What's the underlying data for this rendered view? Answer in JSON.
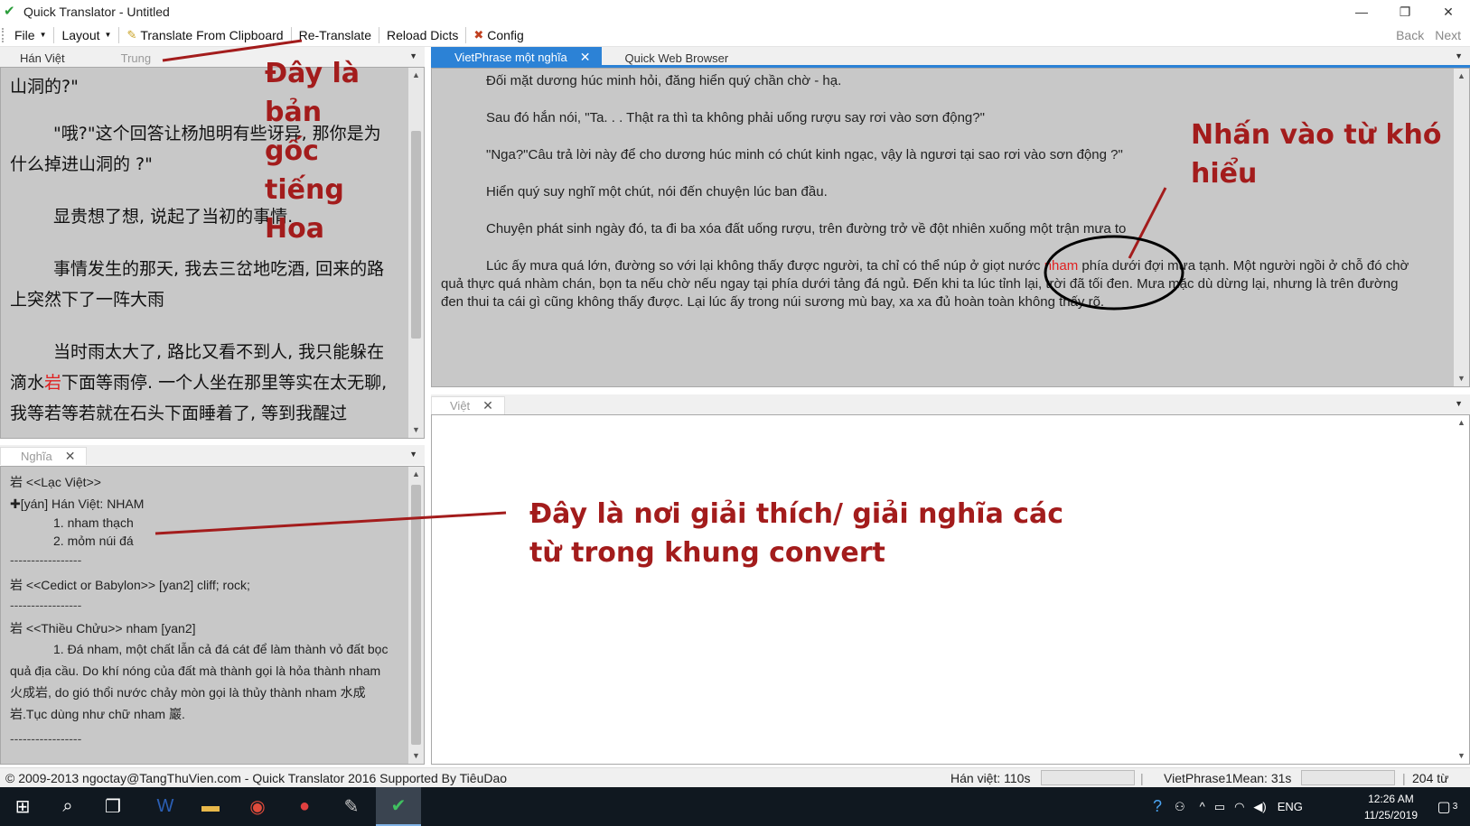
{
  "window": {
    "title": "Quick Translator - Untitled",
    "min": "—",
    "restore": "❐",
    "close": "✕"
  },
  "menu": {
    "file": "File",
    "layout": "Layout",
    "clipboard": "Translate From Clipboard",
    "retranslate": "Re-Translate",
    "reload": "Reload Dicts",
    "config": "Config",
    "back": "Back",
    "next": "Next"
  },
  "tabs_left": {
    "han_viet": "Hán Việt",
    "trung": "Trung"
  },
  "tabs_right": {
    "vietphrase": "VietPhrase một nghĩa",
    "browser": "Quick Web Browser"
  },
  "tab_viet": "Việt",
  "tab_nghia": "Nghĩa",
  "chinese": {
    "l1": "山洞的?\"",
    "p2": "\"哦?\"这个回答让杨旭明有些讶异, 那你是为什么掉进山洞的 ?\"",
    "p3": "显贵想了想, 说起了当初的事情.",
    "p4": "事情发生的那天, 我去三岔地吃酒, 回来的路上突然下了一阵大雨",
    "p5a": "当时雨太大了, 路比又看不到人, 我只能躲在滴水",
    "p5b": "岩",
    "p5c": "下面等雨停. 一个人坐在那里等实在太无聊, 我等若等若就在石头下面睡着了, 等到我醒过"
  },
  "vietphrase": {
    "p1": "Đối mặt dương húc minh hỏi, đăng hiển quý chần chờ - hạ.",
    "p2": "Sau đó hắn nói, \"Ta. . . Thật ra thì ta không phải uống rượu say rơi vào sơn động?\"",
    "p3": "\"Nga?\"Câu trả lời này để cho dương húc minh có chút kinh ngạc, vậy là ngươi tại sao rơi vào sơn động ?\"",
    "p4": "Hiển quý suy nghĩ một chút, nói đến chuyện lúc ban đầu.",
    "p5": "Chuyện phát sinh ngày đó, ta đi ba xóa đất uống rượu, trên đường trở về đột nhiên xuống một trận mưa to",
    "p6a": "Lúc ấy mưa quá lớn, đường so với lại không thấy được người, ta chỉ có thể núp ở giọt nước ",
    "p6b": "nham",
    "p6c": " phía dưới đợi mưa tạnh. Một người ngồi ở chỗ đó chờ quả thực quá nhàm chán, bọn ta nếu chờ nếu ngay tại phía dưới tảng đá ngủ. Đến khi ta lúc tỉnh lại, trời đã tối đen. Mưa mặc dù dừng lại, nhưng là trên đường đen thui ta cái gì cũng không thấy được. Lại lúc ấy trong núi sương mù bay, xa xa đủ hoàn toàn không thấy rõ."
  },
  "dict": {
    "l1": "岩 <<Lạc Việt>>",
    "l2": "✚[yán] Hán Việt: NHAM",
    "l3": "1. nham thạch",
    "l4": "2. mỏm núi đá",
    "sep": "-----------------",
    "l5": "岩 <<Cedict or Babylon>>  [yan2] cliff; rock;",
    "l6": "岩 <<Thiều Chửu>> nham [yan2]",
    "l7": "1. Đá nham, một chất lẫn cả đá cát để làm thành vỏ đất bọc quả địa cầu. Do khí nóng của đất mà thành gọi là hỏa thành nham 火成岩, do gió thổi nước chảy mòn gọi là thủy thành nham 水成岩.Tục dùng như chữ nham 巖."
  },
  "annotations": {
    "original": [
      "Đây là",
      "bản",
      "gốc",
      "tiếng",
      "Hoa"
    ],
    "click": [
      "Nhấn vào từ khó",
      "hiểu"
    ],
    "explain": [
      "Đây là nơi giải thích/ giải nghĩa các",
      "từ trong khung convert"
    ]
  },
  "status": {
    "copyright": "© 2009-2013 ngoctay@TangThuVien.com - Quick Translator 2016 Supported By TiêuDao",
    "hanviet": "Hán việt: 110s",
    "vp": "VietPhrase1Mean: 31s",
    "words": "204 từ"
  },
  "taskbar": {
    "lang": "ENG",
    "time": "12:26 AM",
    "date": "11/25/2019",
    "notif": "3"
  },
  "colors": {
    "annotation": "#a31c1c",
    "tab_active": "#2c82d6",
    "highlight": "#e02020"
  }
}
